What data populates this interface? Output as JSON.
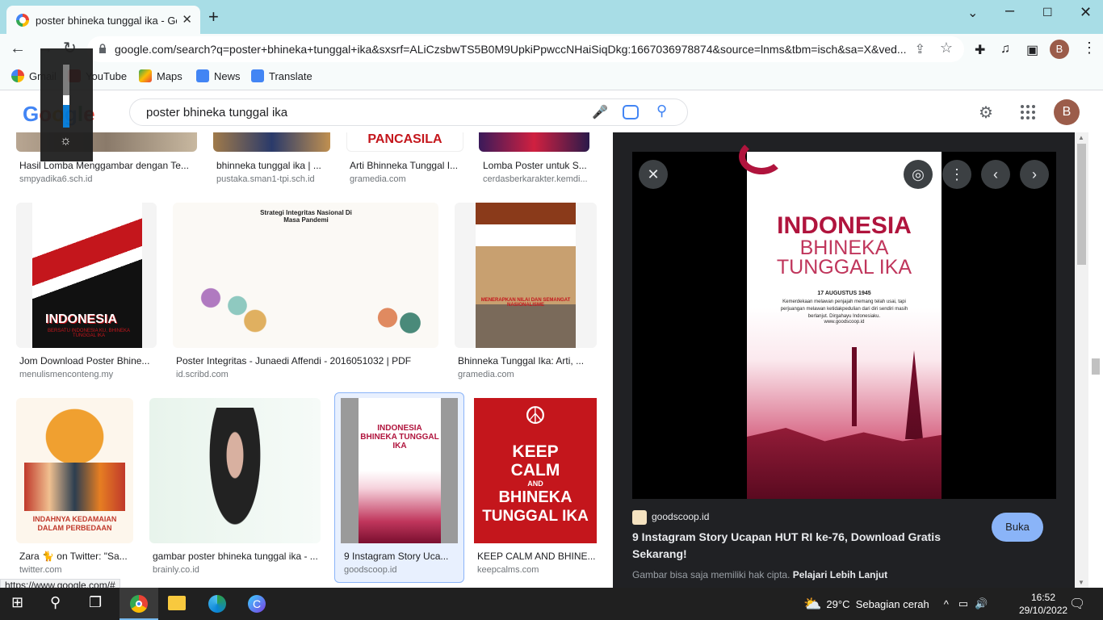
{
  "browser": {
    "tab_title": "poster bhineka tunggal ika - Goo",
    "url": "google.com/search?q=poster+bhineka+tunggal+ika&sxsrf=ALiCzsbwTS5B0M9UpkiPpwccNHaiSiqDkg:1667036978874&source=lnms&tbm=isch&sa=X&ved...",
    "profile_initial": "B",
    "bookmarks": [
      "Gmail",
      "YouTube",
      "Maps",
      "News",
      "Translate"
    ]
  },
  "google": {
    "logo": "Google",
    "query": "poster bhineka tunggal ika",
    "avatar": "B"
  },
  "results_row1": [
    {
      "caption": "Hasil Lomba Menggambar dengan Te...",
      "source": "smpyadika6.sch.id"
    },
    {
      "caption": "bhinneka tunggal ika | ...",
      "source": "pustaka.sman1-tpi.sch.id"
    },
    {
      "caption": "Arti Bhinneka Tunggal I...",
      "source": "gramedia.com"
    },
    {
      "caption": "Lomba Poster untuk S...",
      "source": "cerdasberkarakter.kemdi..."
    }
  ],
  "row1_thumb_texts": {
    "pancasila": "PANCASILA"
  },
  "results_row2": [
    {
      "caption": "Jom Download Poster Bhine...",
      "source": "menulismenconteng.my",
      "thumb_text": "INDONESIA",
      "thumb_sub": "BERSATU INDONESIA KU, BHINEKA TUNGGAL IKA"
    },
    {
      "caption": "Poster Integritas - Junaedi Affendi - 2016051032 | PDF",
      "source": "id.scribd.com",
      "thumb_text": "Strategi Integritas Nasional Di Masa Pandemi"
    },
    {
      "caption": "Bhinneka Tunggal Ika: Arti, ...",
      "source": "gramedia.com",
      "thumb_text": "MENERAPKAN NILAI DAN SEMANGAT NASIONALISME"
    }
  ],
  "results_row3": [
    {
      "caption": "Zara 🐈 on Twitter: \"Sa...",
      "source": "twitter.com",
      "thumb_text": "INDAHNYA KEDAMAIAN DALAM PERBEDAAN"
    },
    {
      "caption": "gambar poster bhineka tunggal ika - ...",
      "source": "brainly.co.id"
    },
    {
      "caption": "9 Instagram Story Uca...",
      "source": "goodscoop.id",
      "thumb_text": "INDONESIA BHINEKA TUNGGAL IKA"
    },
    {
      "caption": "KEEP CALM AND BHINE...",
      "source": "keepcalms.com",
      "thumb_lines": [
        "KEEP",
        "CALM",
        "AND",
        "BHINEKA",
        "TUNGGAL IKA"
      ]
    }
  ],
  "preview": {
    "poster_line1": "INDONESIA",
    "poster_line2": "BHINEKA",
    "poster_line3": "TUNGGAL IKA",
    "poster_date": "17 AUGUSTUS 1945",
    "poster_body": "Kemerdekaan melawan penjajah memang telah usai, tapi perjuangan melawan ketidakpedulian dari diri sendiri masih berlanjut. Dirgahayu Indonesiaku.",
    "poster_url": "www.goodscoop.id",
    "source": "goodscoop.id",
    "title": "9 Instagram Story Ucapan HUT RI ke-76, Download Gratis Sekarang!",
    "button": "Buka",
    "note": "Gambar bisa saja memiliki hak cipta.",
    "note_link": "Pelajari Lebih Lanjut"
  },
  "status_url": "https://www.google.com/#",
  "taskbar": {
    "weather": "29°C  Sebagian cerah",
    "time": "16:52",
    "date": "29/10/2022"
  },
  "colors": {
    "accent": "#1a73e8",
    "titlebar": "#a8dde6",
    "panel": "#202124",
    "poster_red": "#b0143d"
  }
}
